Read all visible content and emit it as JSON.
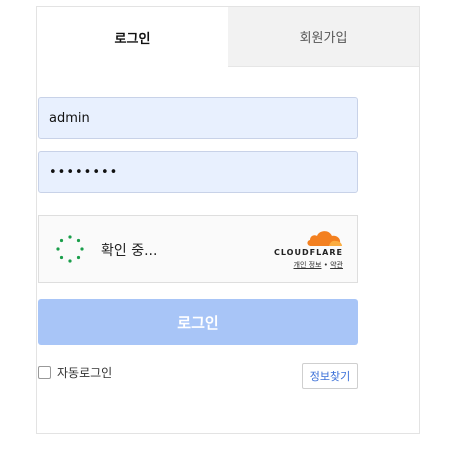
{
  "tabs": {
    "login": "로그인",
    "signup": "회원가입"
  },
  "form": {
    "username_value": "admin",
    "password_value": "••••••••"
  },
  "captcha": {
    "status_text": "확인 중...",
    "brand": "CLOUDFLARE",
    "privacy_link": "개인 정보",
    "separator": "•",
    "terms_link": "약관"
  },
  "buttons": {
    "login": "로그인",
    "find_info": "정보찾기"
  },
  "auto_login": {
    "label": "자동로그인",
    "checked": false
  },
  "colors": {
    "login_button": "#a8c5f7",
    "input_bg": "#e8f0fe",
    "cloudflare_orange": "#f38020"
  },
  "icons": {
    "spinner": "loading-spinner-icon",
    "cloudflare": "cloudflare-cloud-icon"
  }
}
